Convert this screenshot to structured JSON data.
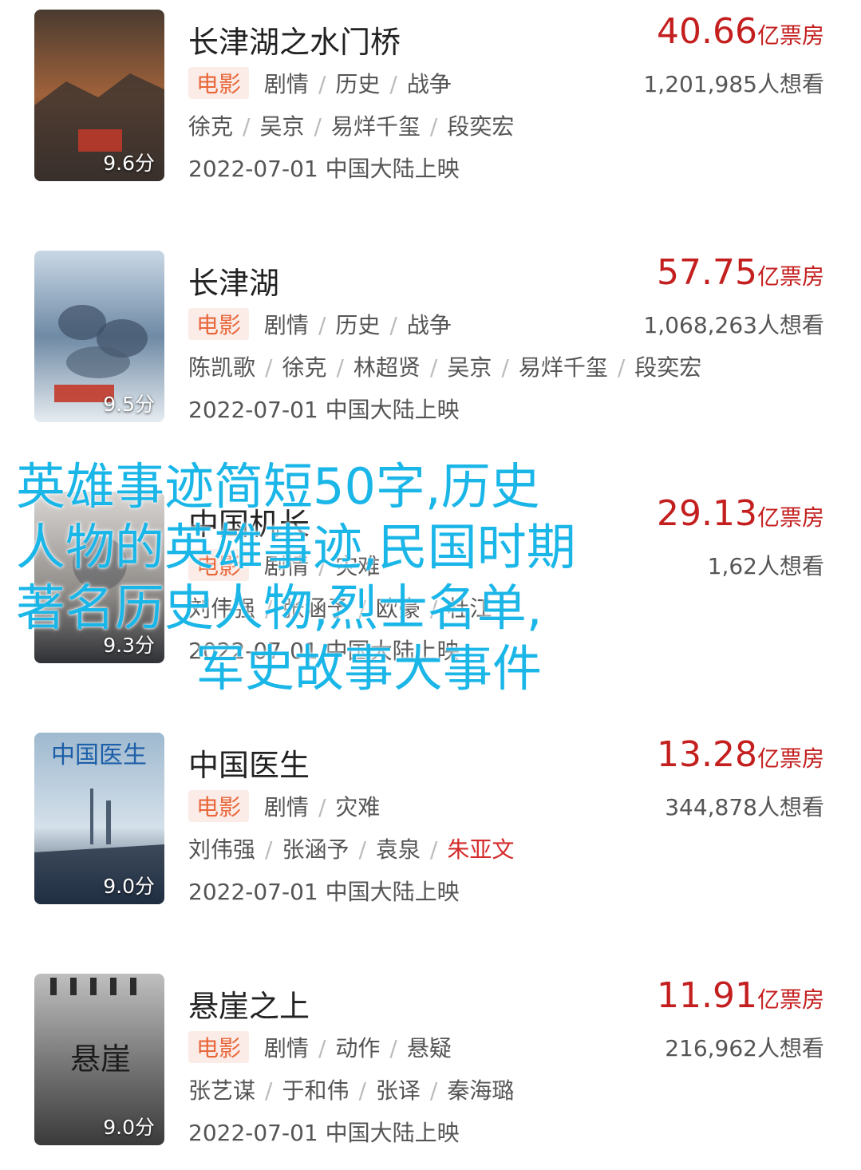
{
  "movies": [
    {
      "title": "长津湖之水门桥",
      "score": "9.6分",
      "box_office_num": "40.66",
      "box_office_unit": "亿票房",
      "tag": "电影",
      "genres": [
        "剧情",
        "历史",
        "战争"
      ],
      "want": "1,201,985人想看",
      "cast": [
        "徐克",
        "吴京",
        "易烊千玺",
        "段奕宏"
      ],
      "release": "2022-07-01 中国大陆上映"
    },
    {
      "title": "长津湖",
      "score": "9.5分",
      "box_office_num": "57.75",
      "box_office_unit": "亿票房",
      "tag": "电影",
      "genres": [
        "剧情",
        "历史",
        "战争"
      ],
      "want": "1,068,263人想看",
      "cast": [
        "陈凯歌",
        "徐克",
        "林超贤",
        "吴京",
        "易烊千玺",
        "段奕宏"
      ],
      "release": "2022-07-01 中国大陆上映"
    },
    {
      "title": "中国机长",
      "score": "9.3分",
      "box_office_num": "29.13",
      "box_office_unit": "亿票房",
      "tag": "电影",
      "genres": [
        "剧情",
        "灾难"
      ],
      "want": "1,62人想看",
      "cast": [
        "刘伟强",
        "张涵予",
        "欧豪",
        "杜江"
      ],
      "release": "2022-07-01 中国大陆上映"
    },
    {
      "title": "中国医生",
      "score": "9.0分",
      "box_office_num": "13.28",
      "box_office_unit": "亿票房",
      "tag": "电影",
      "genres": [
        "剧情",
        "灾难"
      ],
      "want": "344,878人想看",
      "cast": [
        "刘伟强",
        "张涵予",
        "袁泉",
        "朱亚文"
      ],
      "release": "2022-07-01 中国大陆上映"
    },
    {
      "title": "悬崖之上",
      "score": "9.0分",
      "box_office_num": "11.91",
      "box_office_unit": "亿票房",
      "tag": "电影",
      "genres": [
        "剧情",
        "动作",
        "悬疑"
      ],
      "want": "216,962人想看",
      "cast": [
        "张艺谋",
        "于和伟",
        "张译",
        "秦海璐"
      ],
      "release": "2022-07-01 中国大陆上映"
    }
  ],
  "overlay_lines": [
    "英雄事迹简短50字,历史",
    "人物的英雄事迹,民国时期",
    "著名历史人物,烈士名单,",
    "军史故事大事件"
  ],
  "colors": {
    "box_office": "#c41f1f",
    "tag_text": "#e8663a",
    "tag_bg": "#fbece7",
    "overlay": "#1bb6e8",
    "highlight_cast": "#d42b2b"
  },
  "poster_icons": [
    "poster-image",
    "poster-image",
    "poster-image",
    "poster-image",
    "poster-image"
  ]
}
